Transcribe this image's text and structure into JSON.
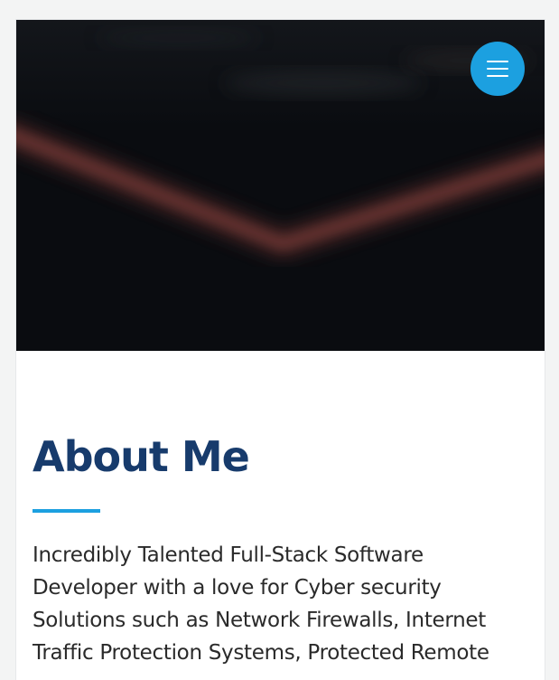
{
  "header": {
    "menu_icon": "hamburger-menu-icon",
    "menu_button_color": "#1ca0e0"
  },
  "hero": {
    "background_color": "#0a0c10",
    "accent_glow_color": "#7a3a36"
  },
  "about": {
    "title": "About Me",
    "title_color": "#173b6c",
    "underline_color": "#1ca0e0",
    "body": "Incredibly Talented Full-Stack Software Developer with a love for Cyber security Solutions such as Network Firewalls, Internet Traffic Protection Systems, Protected Remote"
  }
}
